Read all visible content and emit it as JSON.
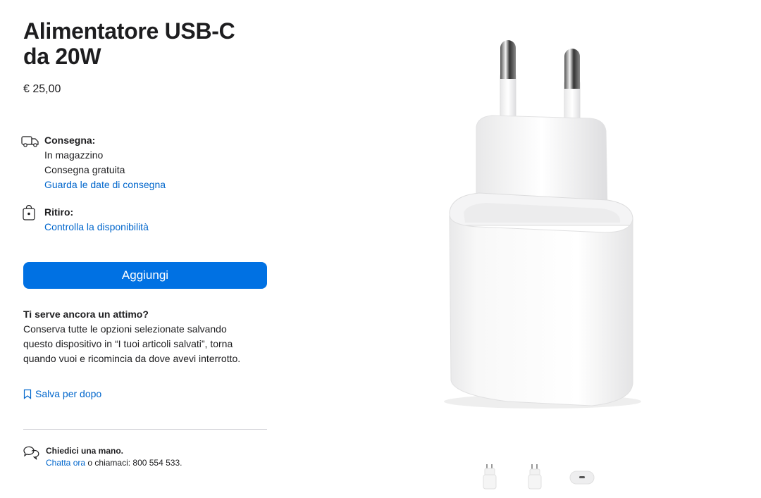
{
  "product": {
    "title_line1": "Alimentatore USB-C",
    "title_line2": "da 20W",
    "price": "€ 25,00"
  },
  "delivery": {
    "label": "Consegna:",
    "stock": "In magazzino",
    "shipping": "Consegna gratuita",
    "dates_link": "Guarda le date di consegna",
    "icon": "truck-icon"
  },
  "pickup": {
    "label": "Ritiro:",
    "availability_link": "Controlla la disponibilità",
    "icon": "shopping-bag-icon"
  },
  "add_button": "Aggiungi",
  "save": {
    "heading": "Ti serve ancora un attimo?",
    "body": "Conserva tutte le opzioni selezionate salvando questo dispositivo in “I tuoi articoli salvati”, torna quando vuoi e ricomincia da dove avevi interrotto.",
    "link": "Salva per dopo",
    "icon": "bookmark-icon"
  },
  "help": {
    "label": "Chiedici una mano.",
    "chat_link": "Chatta ora",
    "phone_text": " o chiamaci: 800 554 533.",
    "icon": "chat-bubbles-icon"
  },
  "colors": {
    "accent": "#0071e3",
    "link": "#0066cc",
    "text": "#1d1d1f"
  },
  "gallery": {
    "thumbnails": [
      "charger-front-thumb",
      "charger-side-thumb",
      "usb-c-port-thumb"
    ]
  }
}
